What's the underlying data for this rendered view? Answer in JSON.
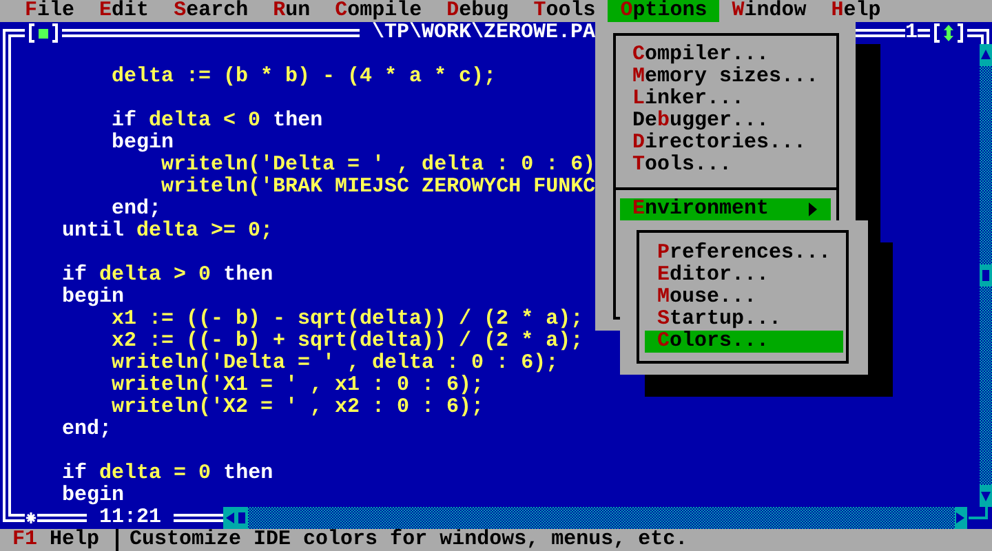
{
  "menu_bar": [
    {
      "hotkey": "F",
      "after": "ile",
      "selected": false
    },
    {
      "hotkey": "E",
      "after": "dit",
      "selected": false
    },
    {
      "hotkey": "S",
      "after": "earch",
      "selected": false
    },
    {
      "hotkey": "R",
      "after": "un",
      "selected": false
    },
    {
      "hotkey": "C",
      "after": "ompile",
      "selected": false
    },
    {
      "hotkey": "D",
      "after": "ebug",
      "selected": false
    },
    {
      "hotkey": "T",
      "after": "ools",
      "selected": false
    },
    {
      "hotkey": "O",
      "after": "ptions",
      "selected": true
    },
    {
      "hotkey": "W",
      "after": "indow",
      "selected": false
    },
    {
      "hotkey": "H",
      "after": "elp",
      "selected": false
    }
  ],
  "editor": {
    "title": "\\TP\\WORK\\ZEROWE.PA",
    "window_number": "1",
    "modified": true,
    "cursor_position": "11:21",
    "lines": [
      {
        "kind": "blank"
      },
      {
        "kind": "code",
        "segments": [
          {
            "text": "        delta := (b * b) - (4 * a * c);",
            "kind": "plain"
          }
        ]
      },
      {
        "kind": "blank"
      },
      {
        "kind": "code",
        "segments": [
          {
            "text": "        if",
            "kind": "keyword"
          },
          {
            "text": " delta < 0 ",
            "kind": "plain"
          },
          {
            "text": "then",
            "kind": "keyword"
          }
        ]
      },
      {
        "kind": "code",
        "segments": [
          {
            "text": "        begin",
            "kind": "keyword"
          }
        ]
      },
      {
        "kind": "code",
        "segments": [
          {
            "text": "            writeln('Delta = ' , delta : 0 : 6)",
            "kind": "plain"
          }
        ]
      },
      {
        "kind": "code",
        "segments": [
          {
            "text": "            writeln('BRAK MIEJSC ZEROWYCH FUNKC",
            "kind": "plain"
          }
        ]
      },
      {
        "kind": "code",
        "segments": [
          {
            "text": "        end;",
            "kind": "keyword"
          }
        ]
      },
      {
        "kind": "code",
        "segments": [
          {
            "text": "    until",
            "kind": "keyword"
          },
          {
            "text": " delta >= 0;",
            "kind": "plain"
          }
        ]
      },
      {
        "kind": "blank"
      },
      {
        "kind": "code",
        "segments": [
          {
            "text": "    if",
            "kind": "keyword"
          },
          {
            "text": " delta > 0 ",
            "kind": "plain"
          },
          {
            "text": "then",
            "kind": "keyword"
          }
        ]
      },
      {
        "kind": "code",
        "segments": [
          {
            "text": "    begin",
            "kind": "keyword"
          }
        ]
      },
      {
        "kind": "code",
        "segments": [
          {
            "text": "        x1 := ((- b) - sqrt(delta)) / (2 * a);",
            "kind": "plain"
          }
        ]
      },
      {
        "kind": "code",
        "segments": [
          {
            "text": "        x2 := ((- b) + sqrt(delta)) / (2 * a);",
            "kind": "plain"
          }
        ]
      },
      {
        "kind": "code",
        "segments": [
          {
            "text": "        writeln('Delta = ' , delta : 0 : 6);",
            "kind": "plain"
          }
        ]
      },
      {
        "kind": "code",
        "segments": [
          {
            "text": "        writeln('X1 = ' , x1 : 0 : 6);",
            "kind": "plain"
          }
        ]
      },
      {
        "kind": "code",
        "segments": [
          {
            "text": "        writeln('X2 = ' , x2 : 0 : 6);",
            "kind": "plain"
          }
        ]
      },
      {
        "kind": "code",
        "segments": [
          {
            "text": "    end;",
            "kind": "keyword"
          }
        ]
      },
      {
        "kind": "blank"
      },
      {
        "kind": "code",
        "segments": [
          {
            "text": "    if",
            "kind": "keyword"
          },
          {
            "text": " delta = 0 ",
            "kind": "plain"
          },
          {
            "text": "then",
            "kind": "keyword"
          }
        ]
      },
      {
        "kind": "code",
        "segments": [
          {
            "text": "    begin",
            "kind": "keyword"
          }
        ]
      }
    ]
  },
  "options_menu": {
    "items": [
      {
        "kind": "item",
        "hotkey": "C",
        "after": "ompiler...",
        "selected": false
      },
      {
        "kind": "item",
        "hotkey": "M",
        "after": "emory sizes...",
        "selected": false
      },
      {
        "kind": "item",
        "hotkey": "L",
        "after": "inker...",
        "selected": false
      },
      {
        "kind": "item",
        "before": "De",
        "hotkey": "b",
        "after": "ugger...",
        "selected": false
      },
      {
        "kind": "item",
        "hotkey": "D",
        "after": "irectories...",
        "selected": false
      },
      {
        "kind": "item",
        "hotkey": "T",
        "after": "ools...",
        "selected": false
      },
      {
        "kind": "separator"
      },
      {
        "kind": "submenu",
        "hotkey": "E",
        "after": "nvironment",
        "selected": true
      }
    ]
  },
  "environment_submenu": {
    "items": [
      {
        "hotkey": "P",
        "after": "references...",
        "selected": false
      },
      {
        "hotkey": "E",
        "after": "ditor...",
        "selected": false
      },
      {
        "hotkey": "M",
        "after": "ouse...",
        "selected": false
      },
      {
        "hotkey": "S",
        "after": "tartup...",
        "selected": false
      },
      {
        "hotkey": "C",
        "after": "olors...",
        "selected": true
      }
    ]
  },
  "status_bar": {
    "key": "F1",
    "key_label": "Help",
    "message": "Customize IDE colors for windows, menus, etc."
  }
}
